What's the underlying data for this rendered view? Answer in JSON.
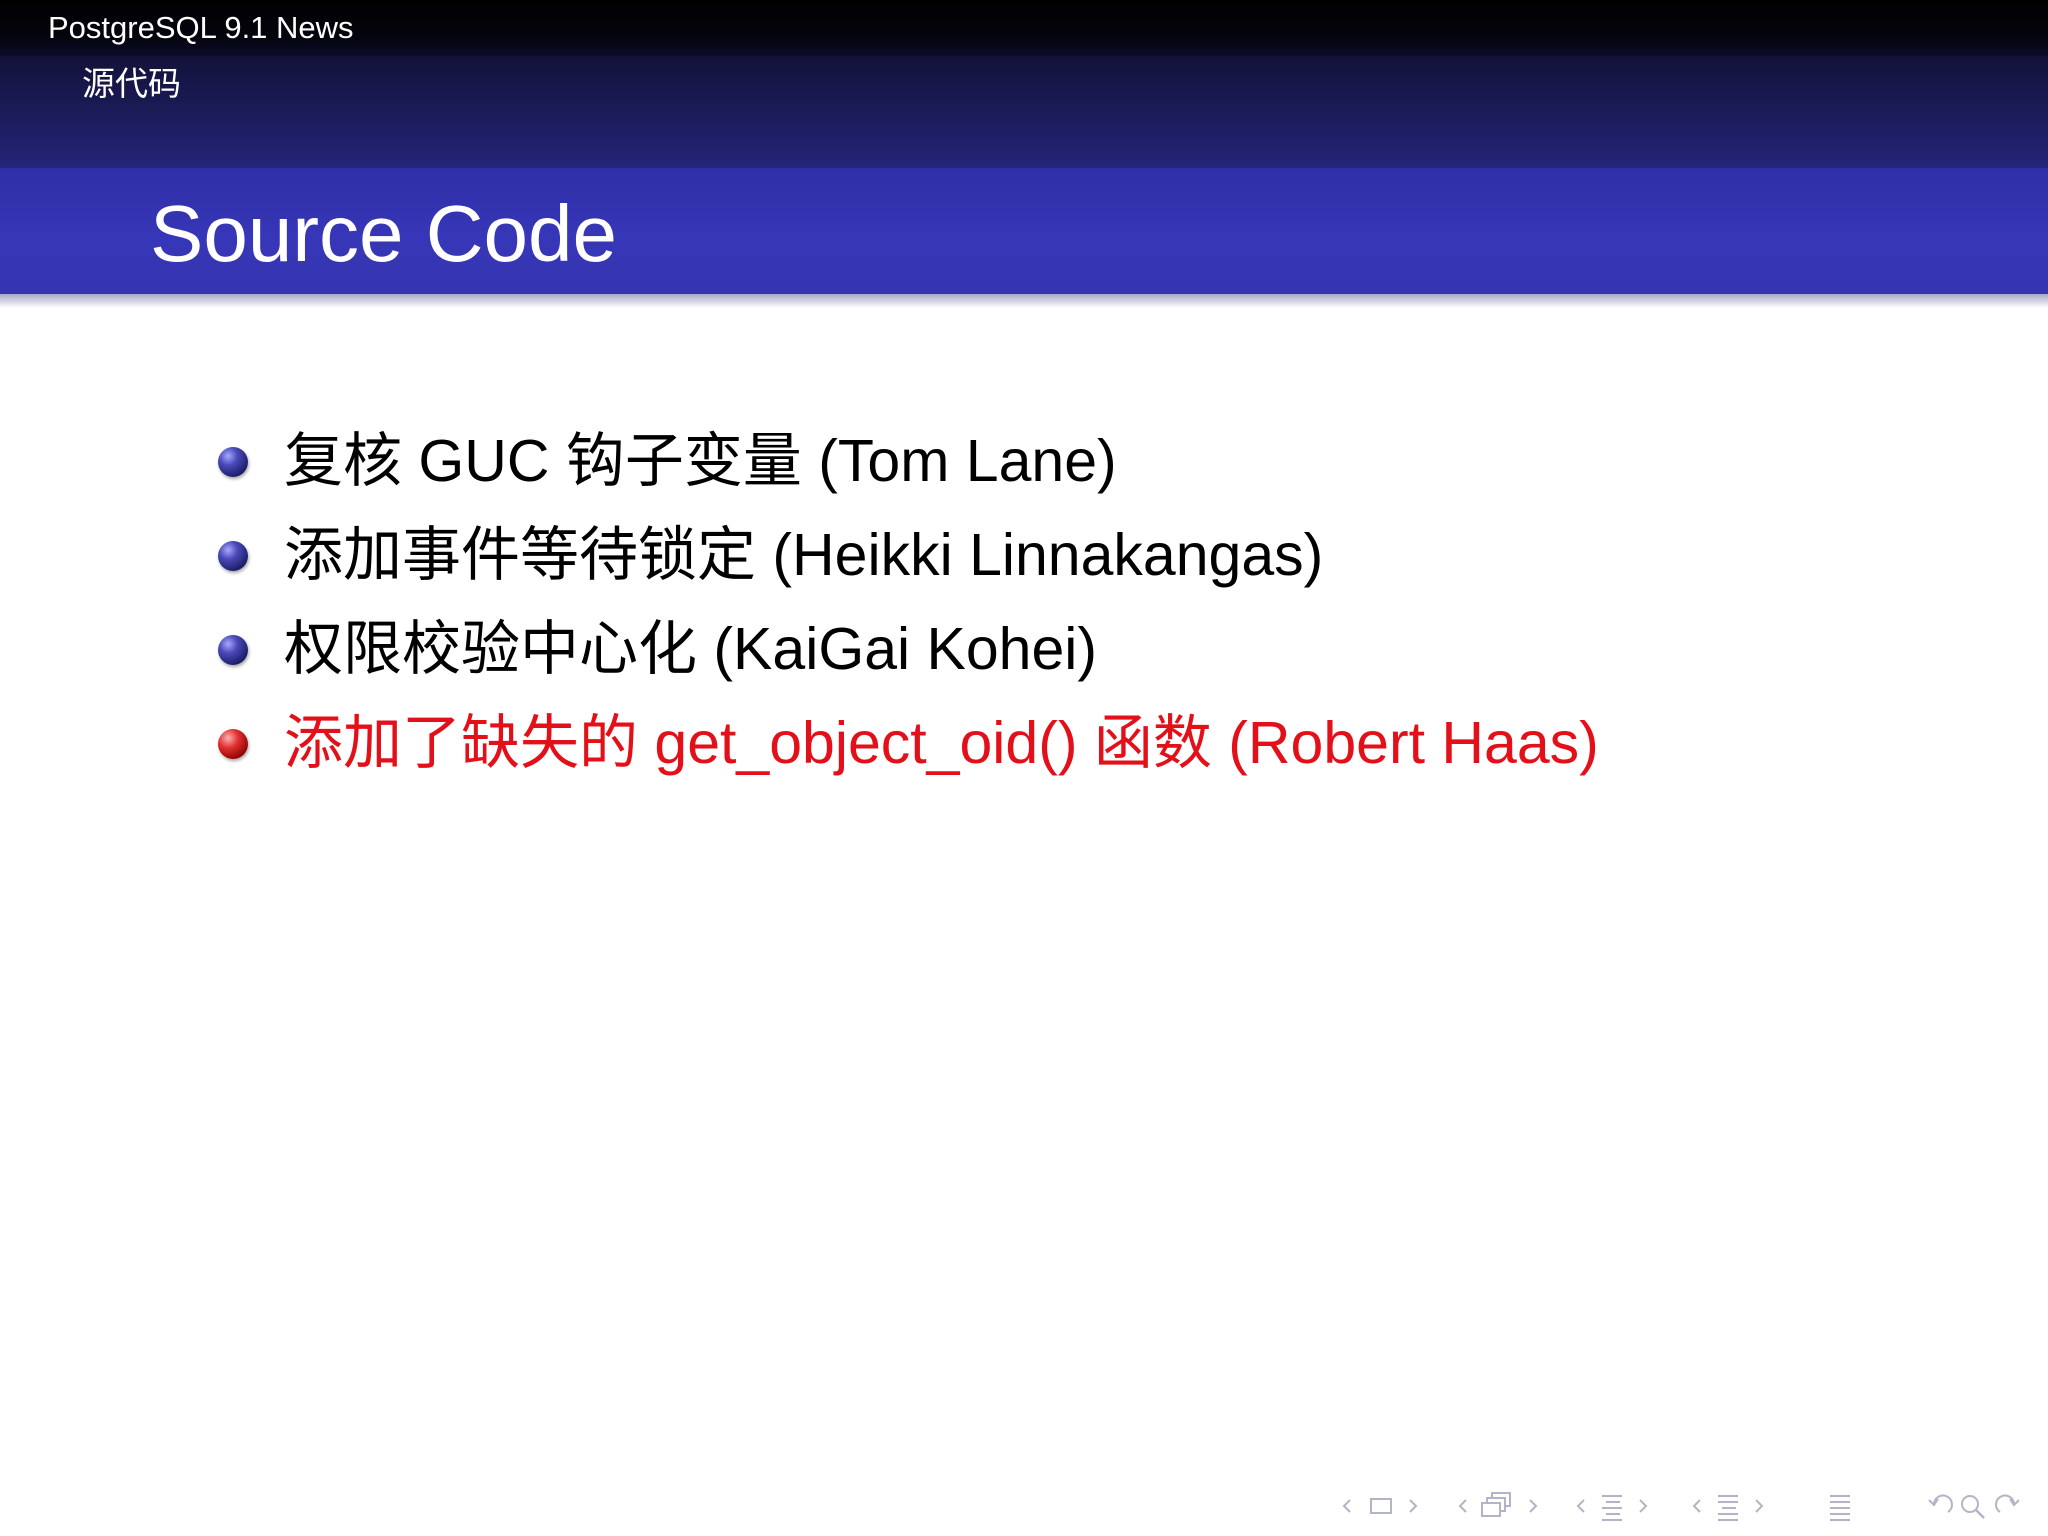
{
  "header": {
    "title": "PostgreSQL 9.1 News",
    "section": "源代码"
  },
  "frame": {
    "title": "Source Code"
  },
  "bullets": [
    {
      "text": "复核 GUC 钩子变量 (Tom Lane)",
      "highlighted": false
    },
    {
      "text": "添加事件等待锁定 (Heikki Linnakangas)",
      "highlighted": false
    },
    {
      "text": "权限校验中心化 (KaiGai Kohei)",
      "highlighted": false
    },
    {
      "text": "添加了缺失的 get_object_oid() 函数 (Robert Haas)",
      "highlighted": true
    }
  ],
  "colors": {
    "header_bar": "#000000",
    "section_bar": "#1a1a55",
    "title_bar": "#3636b8",
    "highlight_text": "#e3101a",
    "bullet_blue": "#2a2a8a",
    "bullet_red": "#c81010",
    "nav_icons": "#b4b4c8"
  },
  "navigation": {
    "icons": [
      "nav-prev-slide-icon",
      "nav-slide-icon",
      "nav-next-slide-icon",
      "nav-prev-frame-icon",
      "nav-frame-icon",
      "nav-next-frame-icon",
      "nav-prev-subsection-icon",
      "nav-subsection-icon",
      "nav-next-subsection-icon",
      "nav-prev-section-icon",
      "nav-section-icon",
      "nav-next-section-icon",
      "nav-toc-icon",
      "nav-back-icon",
      "nav-search-icon",
      "nav-forward-icon"
    ]
  }
}
